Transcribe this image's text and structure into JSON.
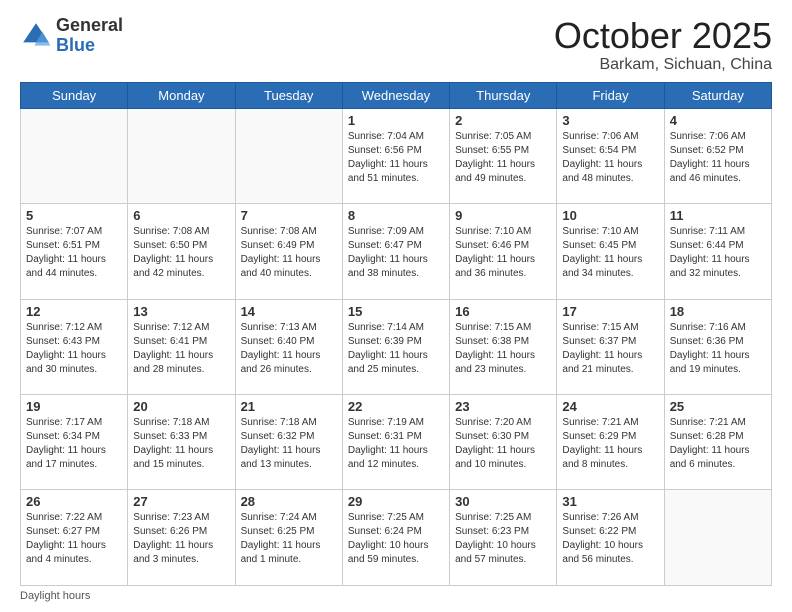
{
  "header": {
    "logo_general": "General",
    "logo_blue": "Blue",
    "title": "October 2025",
    "location": "Barkam, Sichuan, China"
  },
  "weekdays": [
    "Sunday",
    "Monday",
    "Tuesday",
    "Wednesday",
    "Thursday",
    "Friday",
    "Saturday"
  ],
  "weeks": [
    [
      {
        "day": "",
        "info": ""
      },
      {
        "day": "",
        "info": ""
      },
      {
        "day": "",
        "info": ""
      },
      {
        "day": "1",
        "info": "Sunrise: 7:04 AM\nSunset: 6:56 PM\nDaylight: 11 hours\nand 51 minutes."
      },
      {
        "day": "2",
        "info": "Sunrise: 7:05 AM\nSunset: 6:55 PM\nDaylight: 11 hours\nand 49 minutes."
      },
      {
        "day": "3",
        "info": "Sunrise: 7:06 AM\nSunset: 6:54 PM\nDaylight: 11 hours\nand 48 minutes."
      },
      {
        "day": "4",
        "info": "Sunrise: 7:06 AM\nSunset: 6:52 PM\nDaylight: 11 hours\nand 46 minutes."
      }
    ],
    [
      {
        "day": "5",
        "info": "Sunrise: 7:07 AM\nSunset: 6:51 PM\nDaylight: 11 hours\nand 44 minutes."
      },
      {
        "day": "6",
        "info": "Sunrise: 7:08 AM\nSunset: 6:50 PM\nDaylight: 11 hours\nand 42 minutes."
      },
      {
        "day": "7",
        "info": "Sunrise: 7:08 AM\nSunset: 6:49 PM\nDaylight: 11 hours\nand 40 minutes."
      },
      {
        "day": "8",
        "info": "Sunrise: 7:09 AM\nSunset: 6:47 PM\nDaylight: 11 hours\nand 38 minutes."
      },
      {
        "day": "9",
        "info": "Sunrise: 7:10 AM\nSunset: 6:46 PM\nDaylight: 11 hours\nand 36 minutes."
      },
      {
        "day": "10",
        "info": "Sunrise: 7:10 AM\nSunset: 6:45 PM\nDaylight: 11 hours\nand 34 minutes."
      },
      {
        "day": "11",
        "info": "Sunrise: 7:11 AM\nSunset: 6:44 PM\nDaylight: 11 hours\nand 32 minutes."
      }
    ],
    [
      {
        "day": "12",
        "info": "Sunrise: 7:12 AM\nSunset: 6:43 PM\nDaylight: 11 hours\nand 30 minutes."
      },
      {
        "day": "13",
        "info": "Sunrise: 7:12 AM\nSunset: 6:41 PM\nDaylight: 11 hours\nand 28 minutes."
      },
      {
        "day": "14",
        "info": "Sunrise: 7:13 AM\nSunset: 6:40 PM\nDaylight: 11 hours\nand 26 minutes."
      },
      {
        "day": "15",
        "info": "Sunrise: 7:14 AM\nSunset: 6:39 PM\nDaylight: 11 hours\nand 25 minutes."
      },
      {
        "day": "16",
        "info": "Sunrise: 7:15 AM\nSunset: 6:38 PM\nDaylight: 11 hours\nand 23 minutes."
      },
      {
        "day": "17",
        "info": "Sunrise: 7:15 AM\nSunset: 6:37 PM\nDaylight: 11 hours\nand 21 minutes."
      },
      {
        "day": "18",
        "info": "Sunrise: 7:16 AM\nSunset: 6:36 PM\nDaylight: 11 hours\nand 19 minutes."
      }
    ],
    [
      {
        "day": "19",
        "info": "Sunrise: 7:17 AM\nSunset: 6:34 PM\nDaylight: 11 hours\nand 17 minutes."
      },
      {
        "day": "20",
        "info": "Sunrise: 7:18 AM\nSunset: 6:33 PM\nDaylight: 11 hours\nand 15 minutes."
      },
      {
        "day": "21",
        "info": "Sunrise: 7:18 AM\nSunset: 6:32 PM\nDaylight: 11 hours\nand 13 minutes."
      },
      {
        "day": "22",
        "info": "Sunrise: 7:19 AM\nSunset: 6:31 PM\nDaylight: 11 hours\nand 12 minutes."
      },
      {
        "day": "23",
        "info": "Sunrise: 7:20 AM\nSunset: 6:30 PM\nDaylight: 11 hours\nand 10 minutes."
      },
      {
        "day": "24",
        "info": "Sunrise: 7:21 AM\nSunset: 6:29 PM\nDaylight: 11 hours\nand 8 minutes."
      },
      {
        "day": "25",
        "info": "Sunrise: 7:21 AM\nSunset: 6:28 PM\nDaylight: 11 hours\nand 6 minutes."
      }
    ],
    [
      {
        "day": "26",
        "info": "Sunrise: 7:22 AM\nSunset: 6:27 PM\nDaylight: 11 hours\nand 4 minutes."
      },
      {
        "day": "27",
        "info": "Sunrise: 7:23 AM\nSunset: 6:26 PM\nDaylight: 11 hours\nand 3 minutes."
      },
      {
        "day": "28",
        "info": "Sunrise: 7:24 AM\nSunset: 6:25 PM\nDaylight: 11 hours\nand 1 minute."
      },
      {
        "day": "29",
        "info": "Sunrise: 7:25 AM\nSunset: 6:24 PM\nDaylight: 10 hours\nand 59 minutes."
      },
      {
        "day": "30",
        "info": "Sunrise: 7:25 AM\nSunset: 6:23 PM\nDaylight: 10 hours\nand 57 minutes."
      },
      {
        "day": "31",
        "info": "Sunrise: 7:26 AM\nSunset: 6:22 PM\nDaylight: 10 hours\nand 56 minutes."
      },
      {
        "day": "",
        "info": ""
      }
    ]
  ],
  "footer": {
    "note": "Daylight hours"
  }
}
